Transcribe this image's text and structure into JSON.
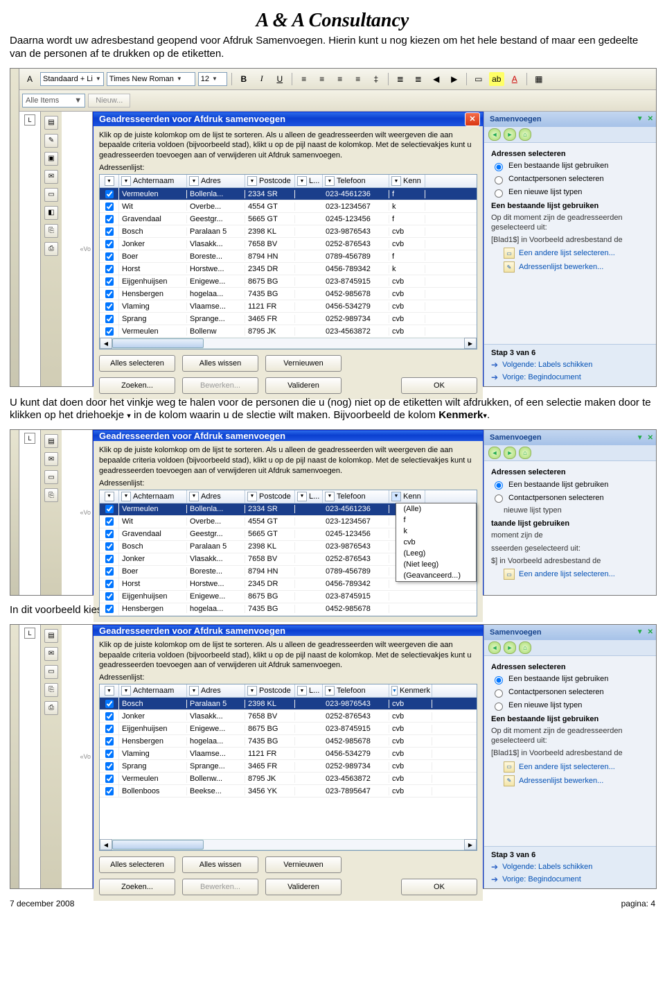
{
  "doc": {
    "title": "A & A Consultancy",
    "para1": "Daarna wordt uw adresbestand geopend voor Afdruk Samenvoegen. Hierin kunt u nog kiezen om het hele bestand of maar een gedeelte van de personen af te drukken op de etiketten.",
    "para2_a": "U kunt dat doen door het vinkje weg te halen voor de personen die u (nog) niet op de etiketten wilt afdrukken, of een selectie maken door te klikken op het driehoekje ",
    "para2_b": " in de kolom waarin u de slectie wilt maken. Bijvoorbeeld de kolom ",
    "para2_bold": "Kenmerk",
    "para2_c": ".",
    "para3": "In dit voorbeeld kies ik even voor cvb. Het resultaat ziet u hieronder.",
    "footer_left": "7 december 2008",
    "footer_right": "pagina: 4"
  },
  "toolbar": {
    "style": "Standaard + Li",
    "font": "Times New Roman",
    "size": "12",
    "alle_items": "Alle Items",
    "nieuw": "Nieuw..."
  },
  "ruler_L": "L",
  "doc_slice": "«Vo",
  "dialog": {
    "title": "Geadresseerden voor Afdruk samenvoegen",
    "instr": "Klik op de juiste kolomkop om de lijst te sorteren. Als u alleen de geadresseerden wilt weergeven die aan bepaalde criteria voldoen (bijvoorbeeld stad), klikt u op de pijl naast de kolomkop. Met de selectievakjes kunt u geadresseerden toevoegen aan of verwijderen uit Afdruk samenvoegen.",
    "list_label": "Adressenlijst:",
    "cols": {
      "achternaam": "Achternaam",
      "adres": "Adres",
      "postcode": "Postcode",
      "l": "L...",
      "telefoon": "Telefoon",
      "kenn": "Kenn"
    },
    "cols3_kenn": "Kenmerk",
    "btns": {
      "alles_sel": "Alles selecteren",
      "alles_wis": "Alles wissen",
      "vernieuwen": "Vernieuwen",
      "zoeken": "Zoeken...",
      "bewerken": "Bewerken...",
      "valideren": "Valideren",
      "ok": "OK"
    }
  },
  "rows1": [
    {
      "ach": "Vermeulen",
      "adr": "Bollenla...",
      "pc": "2334 SR",
      "tel": "023-4561236",
      "ken": "f",
      "sel": true
    },
    {
      "ach": "Wit",
      "adr": "Overbe...",
      "pc": "4554 GT",
      "tel": "023-1234567",
      "ken": "k"
    },
    {
      "ach": "Gravendaal",
      "adr": "Geestgr...",
      "pc": "5665 GT",
      "tel": "0245-123456",
      "ken": "f"
    },
    {
      "ach": "Bosch",
      "adr": "Paralaan 5",
      "pc": "2398 KL",
      "tel": "023-9876543",
      "ken": "cvb"
    },
    {
      "ach": "Jonker",
      "adr": "Vlasakk...",
      "pc": "7658 BV",
      "tel": "0252-876543",
      "ken": "cvb"
    },
    {
      "ach": "Boer",
      "adr": "Boreste...",
      "pc": "8794 HN",
      "tel": "0789-456789",
      "ken": "f"
    },
    {
      "ach": "Horst",
      "adr": "Horstwe...",
      "pc": "2345 DR",
      "tel": "0456-789342",
      "ken": "k"
    },
    {
      "ach": "Eijgenhuijsen",
      "adr": "Enigewe...",
      "pc": "8675 BG",
      "tel": "023-8745915",
      "ken": "cvb"
    },
    {
      "ach": "Hensbergen",
      "adr": "hogelaa...",
      "pc": "7435 BG",
      "tel": "0452-985678",
      "ken": "cvb"
    },
    {
      "ach": "Vlaming",
      "adr": "Vlaamse...",
      "pc": "1121 FR",
      "tel": "0456-534279",
      "ken": "cvb"
    },
    {
      "ach": "Sprang",
      "adr": "Sprange...",
      "pc": "3465 FR",
      "tel": "0252-989734",
      "ken": "cvb"
    },
    {
      "ach": "Vermeulen",
      "adr": "Bollenw",
      "pc": "8795 JK",
      "tel": "023-4563872",
      "ken": "cvb"
    }
  ],
  "rows2": [
    {
      "ach": "Vermeulen",
      "adr": "Bollenla...",
      "pc": "2334 SR",
      "tel": "023-4561236",
      "ken": "",
      "sel": true
    },
    {
      "ach": "Wit",
      "adr": "Overbe...",
      "pc": "4554 GT",
      "tel": "023-1234567",
      "ken": ""
    },
    {
      "ach": "Gravendaal",
      "adr": "Geestgr...",
      "pc": "5665 GT",
      "tel": "0245-123456",
      "ken": ""
    },
    {
      "ach": "Bosch",
      "adr": "Paralaan 5",
      "pc": "2398 KL",
      "tel": "023-9876543",
      "ken": ""
    },
    {
      "ach": "Jonker",
      "adr": "Vlasakk...",
      "pc": "7658 BV",
      "tel": "0252-876543",
      "ken": ""
    },
    {
      "ach": "Boer",
      "adr": "Boreste...",
      "pc": "8794 HN",
      "tel": "0789-456789",
      "ken": ""
    },
    {
      "ach": "Horst",
      "adr": "Horstwe...",
      "pc": "2345 DR",
      "tel": "0456-789342",
      "ken": ""
    },
    {
      "ach": "Eijgenhuijsen",
      "adr": "Enigewe...",
      "pc": "8675 BG",
      "tel": "023-8745915",
      "ken": ""
    },
    {
      "ach": "Hensbergen",
      "adr": "hogelaa...",
      "pc": "7435 BG",
      "tel": "0452-985678",
      "ken": ""
    }
  ],
  "kenn_menu": [
    "(Alle)",
    "f",
    "k",
    "cvb",
    "(Leeg)",
    "(Niet leeg)",
    "(Geavanceerd...)"
  ],
  "rows3": [
    {
      "ach": "Bosch",
      "adr": "Paralaan 5",
      "pc": "2398 KL",
      "tel": "023-9876543",
      "ken": "cvb",
      "sel": true
    },
    {
      "ach": "Jonker",
      "adr": "Vlasakk...",
      "pc": "7658 BV",
      "tel": "0252-876543",
      "ken": "cvb"
    },
    {
      "ach": "Eijgenhuijsen",
      "adr": "Enigewe...",
      "pc": "8675 BG",
      "tel": "023-8745915",
      "ken": "cvb"
    },
    {
      "ach": "Hensbergen",
      "adr": "hogelaa...",
      "pc": "7435 BG",
      "tel": "0452-985678",
      "ken": "cvb"
    },
    {
      "ach": "Vlaming",
      "adr": "Vlaamse...",
      "pc": "1121 FR",
      "tel": "0456-534279",
      "ken": "cvb"
    },
    {
      "ach": "Sprang",
      "adr": "Sprange...",
      "pc": "3465 FR",
      "tel": "0252-989734",
      "ken": "cvb"
    },
    {
      "ach": "Vermeulen",
      "adr": "Bollenw...",
      "pc": "8795 JK",
      "tel": "023-4563872",
      "ken": "cvb"
    },
    {
      "ach": "Bollenboos",
      "adr": "Beekse...",
      "pc": "3456 YK",
      "tel": "023-7895647",
      "ken": "cvb"
    }
  ],
  "taskpane": {
    "title": "Samenvoegen",
    "section1": "Adressen selecteren",
    "r1": "Een bestaande lijst gebruiken",
    "r2": "Contactpersonen selecteren",
    "r3": "Een nieuwe lijst typen",
    "r2_short": "nieuwe lijst typen",
    "section2": "Een bestaande lijst gebruiken",
    "section2_short": "taande lijst gebruiken",
    "sub": "Op dit moment zijn de geadresseerden geselecteerd uit:",
    "sub_short1": "moment zijn de",
    "sub_short2": "sseerden geselecteerd uit:",
    "src": "[Blad1$] in Voorbeeld adresbestand de",
    "src_short": "$] in Voorbeeld adresbestand de",
    "link1": "Een andere lijst selecteren...",
    "link2": "Adressenlijst bewerken...",
    "step": "Stap 3 van 6",
    "next": "Volgende: Labels schikken",
    "prev": "Vorige: Begindocument"
  }
}
